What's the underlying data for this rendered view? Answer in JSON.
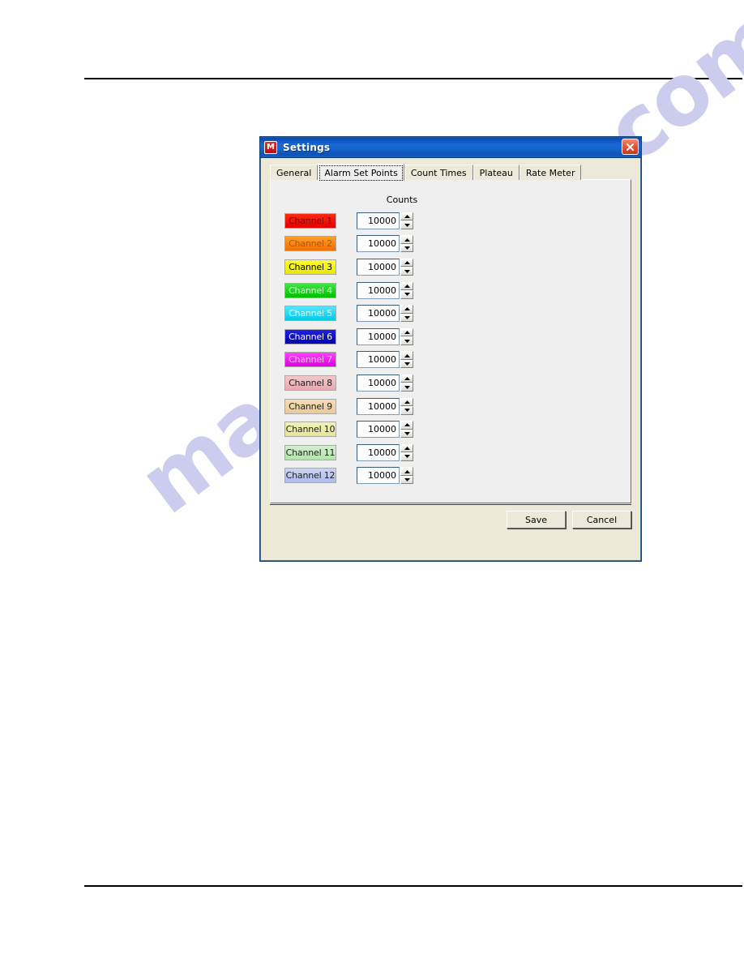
{
  "document": {
    "watermark": "manualslive.com"
  },
  "dialog": {
    "title": "Settings",
    "app_icon": "M",
    "close_icon": "close-icon",
    "tabs": [
      {
        "label": "General",
        "selected": false
      },
      {
        "label": "Alarm Set Points",
        "selected": true
      },
      {
        "label": "Count Times",
        "selected": false
      },
      {
        "label": "Plateau",
        "selected": false
      },
      {
        "label": "Rate Meter",
        "selected": false
      }
    ],
    "column_header": "Counts",
    "channels": [
      {
        "label": "Channel 1",
        "value": "10000",
        "bg_start": "#ff2a10",
        "bg_end": "#e00000",
        "text_color": "#8b0000"
      },
      {
        "label": "Channel 2",
        "value": "10000",
        "bg_start": "#ffa028",
        "bg_end": "#f07000",
        "text_color": "#b85000"
      },
      {
        "label": "Channel 3",
        "value": "10000",
        "bg_start": "#ffff30",
        "bg_end": "#e8e800",
        "text_color": "#000000"
      },
      {
        "label": "Channel 4",
        "value": "10000",
        "bg_start": "#3ce83c",
        "bg_end": "#00c000",
        "text_color": "#d8ffd8"
      },
      {
        "label": "Channel 5",
        "value": "10000",
        "bg_start": "#50e8ff",
        "bg_end": "#00c8e8",
        "text_color": "#e0ffff"
      },
      {
        "label": "Channel 6",
        "value": "10000",
        "bg_start": "#2020e0",
        "bg_end": "#0000b0",
        "text_color": "#ffffff"
      },
      {
        "label": "Channel 7",
        "value": "10000",
        "bg_start": "#ff40ff",
        "bg_end": "#e000e0",
        "text_color": "#ffd0ff"
      },
      {
        "label": "Channel 8",
        "value": "10000",
        "bg_start": "#f5c8cc",
        "bg_end": "#e8a8b0",
        "text_color": "#202020"
      },
      {
        "label": "Channel 9",
        "value": "10000",
        "bg_start": "#f5ddb8",
        "bg_end": "#eac99a",
        "text_color": "#202020"
      },
      {
        "label": "Channel 10",
        "value": "10000",
        "bg_start": "#f2f2b8",
        "bg_end": "#e5e59a",
        "text_color": "#202020"
      },
      {
        "label": "Channel 11",
        "value": "10000",
        "bg_start": "#d2f0cd",
        "bg_end": "#b4e3ad",
        "text_color": "#202020"
      },
      {
        "label": "Channel 12",
        "value": "10000",
        "bg_start": "#ccd4f0",
        "bg_end": "#b0bce8",
        "text_color": "#202020"
      }
    ],
    "spinner_up_icon": "caret-up-icon",
    "spinner_down_icon": "caret-down-icon",
    "buttons": {
      "save": "Save",
      "cancel": "Cancel"
    }
  }
}
